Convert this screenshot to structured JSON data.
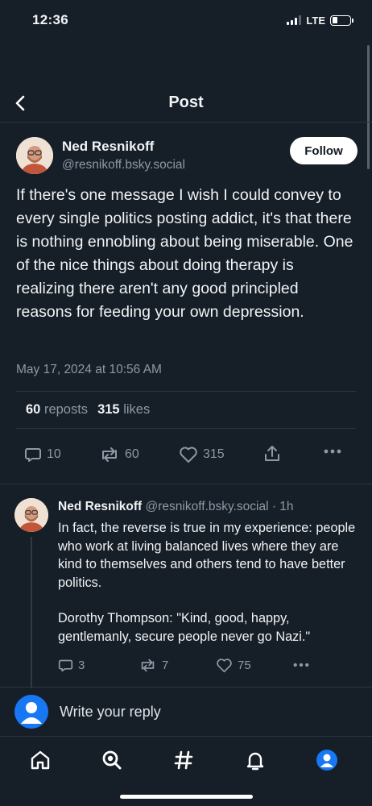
{
  "status_bar": {
    "time": "12:36",
    "network": "LTE",
    "battery_level": 0.3
  },
  "header": {
    "title": "Post",
    "back_icon": "chevron-left-icon"
  },
  "post": {
    "author": {
      "display_name": "Ned Resnikoff",
      "handle": "@resnikoff.bsky.social"
    },
    "follow_label": "Follow",
    "text": "If there's one message I wish I could convey to every single politics posting addict, it's that there is nothing ennobling about being miserable. One of the nice things about doing therapy is realizing there aren't any good principled reasons for feeding your own depression.",
    "date": "May 17, 2024 at 10:56 AM",
    "stats": {
      "reposts_count": "60",
      "reposts_label": "reposts",
      "likes_count": "315",
      "likes_label": "likes"
    },
    "actions": {
      "replies": "10",
      "reposts": "60",
      "likes": "315"
    }
  },
  "reply": {
    "author": {
      "display_name": "Ned Resnikoff",
      "handle": "@resnikoff.bsky.social"
    },
    "meta": "@resnikoff.bsky.social · 1h",
    "text_p1": "In fact, the reverse is true in my experience: people who work at living balanced lives where they are kind to themselves and others tend to have better politics.",
    "text_p2": "Dorothy Thompson: \"Kind, good, happy, gentlemanly, secure people never go Nazi.\"",
    "actions": {
      "replies": "3",
      "reposts": "7",
      "likes": "75"
    }
  },
  "compose": {
    "placeholder": "Write your reply"
  },
  "tabbar": {
    "items": [
      "home-icon",
      "search-icon",
      "feeds-hash-icon",
      "notifications-bell-icon",
      "profile-icon"
    ]
  },
  "colors": {
    "background": "#161e27",
    "muted": "#8d99a6",
    "accent": "#1877f2",
    "divider": "#2a3542"
  }
}
